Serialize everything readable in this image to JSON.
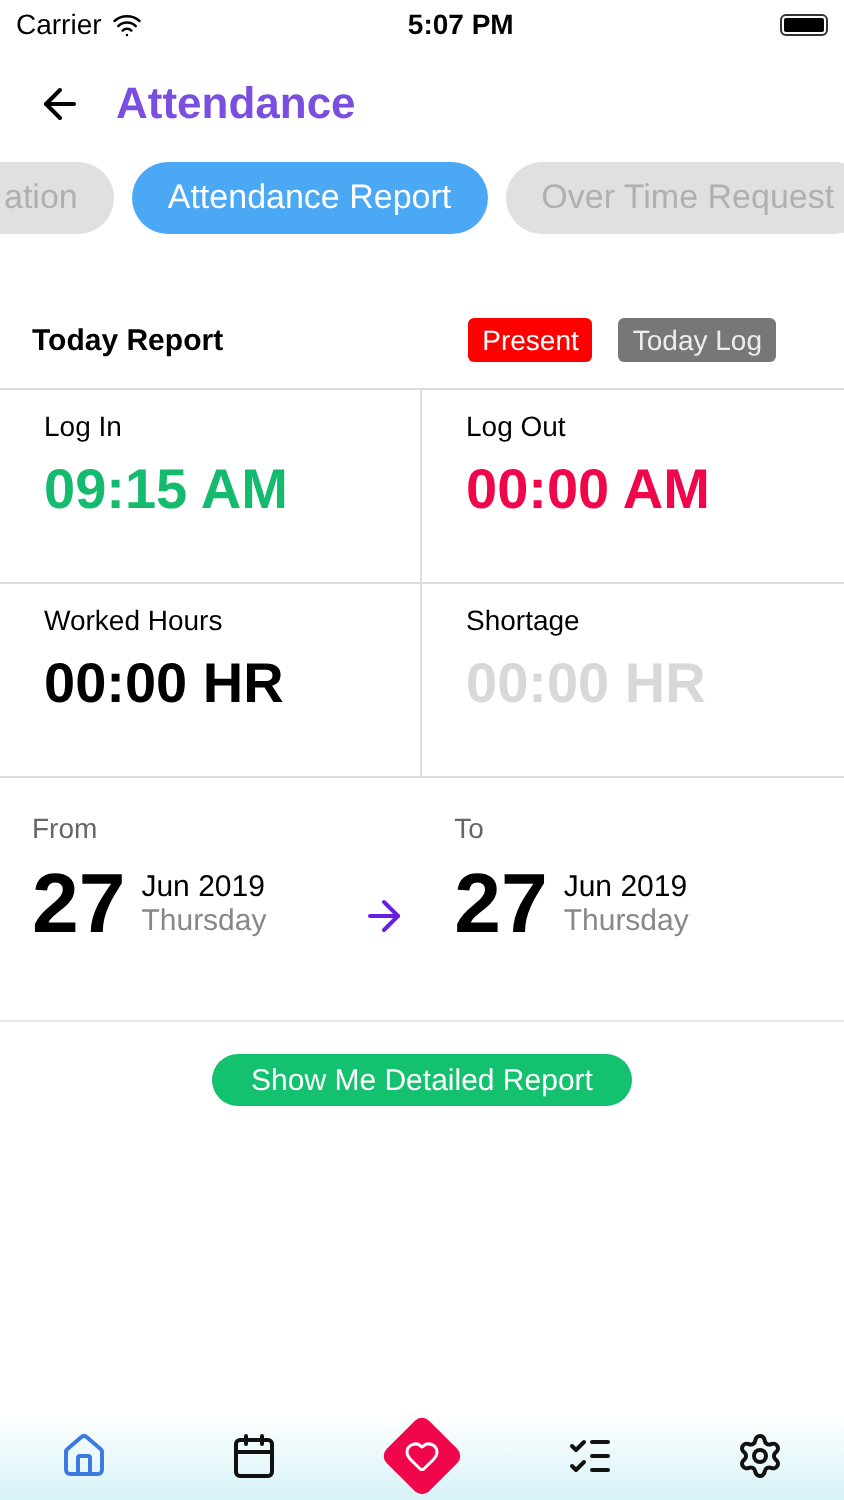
{
  "status_bar": {
    "carrier": "Carrier",
    "time": "5:07 PM"
  },
  "header": {
    "title": "Attendance"
  },
  "tabs": [
    {
      "label": "ation",
      "selected": false
    },
    {
      "label": "Attendance Report",
      "selected": true
    },
    {
      "label": "Over Time Request",
      "selected": false
    }
  ],
  "today": {
    "title": "Today Report",
    "status": "Present",
    "log_button": "Today Log"
  },
  "stats": [
    {
      "label": "Log In",
      "value": "09:15 AM",
      "color": "#14bb6e"
    },
    {
      "label": "Log Out",
      "value": "00:00 AM",
      "color": "#f0064a"
    },
    {
      "label": "Worked Hours",
      "value": "00:00 HR",
      "color": "#000000"
    },
    {
      "label": "Shortage",
      "value": "00:00 HR",
      "color": "#d8d8d8"
    }
  ],
  "range": [
    {
      "label": "From",
      "day": "27",
      "month_year": "Jun 2019",
      "weekday": "Thursday"
    },
    {
      "label": "To",
      "day": "27",
      "month_year": "Jun 2019",
      "weekday": "Thursday"
    }
  ],
  "report_button": "Show Me Detailed Report",
  "nav": [
    {
      "kind": "home",
      "selected": true
    },
    {
      "kind": "calendar",
      "selected": false
    },
    {
      "kind": "heart",
      "selected": false
    },
    {
      "kind": "checklist",
      "selected": false
    },
    {
      "kind": "settings",
      "selected": false
    }
  ]
}
